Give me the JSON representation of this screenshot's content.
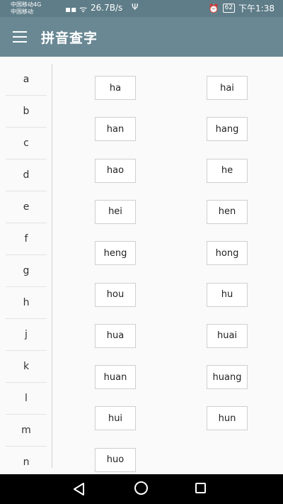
{
  "status_bar": {
    "carrier_line1": "中国移动4G",
    "carrier_line2": "中国移动",
    "signal_icons": "▪▪ ᯤ",
    "net_speed": "26.7B/s",
    "usb_icon": "Ψ",
    "alarm_icon": "⏰",
    "battery_level": "62",
    "time": "下午1:38"
  },
  "app_bar": {
    "title": "拼音查字"
  },
  "letters": [
    "a",
    "b",
    "c",
    "d",
    "e",
    "f",
    "g",
    "h",
    "j",
    "k",
    "l",
    "m",
    "n"
  ],
  "pinyin_items": [
    "ha",
    "hai",
    "han",
    "hang",
    "hao",
    "he",
    "hei",
    "hen",
    "heng",
    "hong",
    "hou",
    "hu",
    "hua",
    "huai",
    "huan",
    "huang",
    "hui",
    "hun",
    "huo"
  ],
  "colors": {
    "status_bar": "#5f7d88",
    "app_bar": "#6a8894",
    "accent_text": "#ffffff"
  }
}
